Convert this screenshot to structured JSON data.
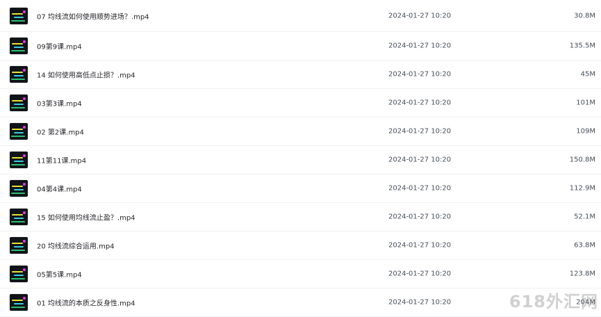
{
  "files": [
    {
      "name": "07 均线流如何使用顺势进场？.mp4",
      "date": "2024-01-27 10:20",
      "size": "30.8M",
      "thumbnail_icon": "video-thumbnail"
    },
    {
      "name": "09第9课.mp4",
      "date": "2024-01-27 10:20",
      "size": "135.5M",
      "thumbnail_icon": "video-thumbnail"
    },
    {
      "name": "14 如何使用高低点止损？.mp4",
      "date": "2024-01-27 10:20",
      "size": "45M",
      "thumbnail_icon": "video-thumbnail"
    },
    {
      "name": "03第3课.mp4",
      "date": "2024-01-27 10:20",
      "size": "101M",
      "thumbnail_icon": "video-thumbnail"
    },
    {
      "name": "02 第2课.mp4",
      "date": "2024-01-27 10:20",
      "size": "109M",
      "thumbnail_icon": "video-thumbnail"
    },
    {
      "name": "11第11课.mp4",
      "date": "2024-01-27 10:20",
      "size": "150.8M",
      "thumbnail_icon": "video-thumbnail"
    },
    {
      "name": "04第4课.mp4",
      "date": "2024-01-27 10:20",
      "size": "112.9M",
      "thumbnail_icon": "video-thumbnail"
    },
    {
      "name": "15 如何使用均线流止盈？.mp4",
      "date": "2024-01-27 10:20",
      "size": "52.1M",
      "thumbnail_icon": "video-thumbnail"
    },
    {
      "name": "20 均线流综合运用.mp4",
      "date": "2024-01-27 10:20",
      "size": "63.8M",
      "thumbnail_icon": "video-thumbnail"
    },
    {
      "name": "05第5课.mp4",
      "date": "2024-01-27 10:20",
      "size": "123.8M",
      "thumbnail_icon": "video-thumbnail"
    },
    {
      "name": "01 均线流的本质之反身性.mp4",
      "date": "2024-01-27 10:20",
      "size": "204M",
      "thumbnail_icon": "video-thumbnail"
    }
  ],
  "watermark": "618外汇网",
  "colors": {
    "text_primary": "#25262b",
    "text_secondary": "#454d5a",
    "divider": "#eef0f4",
    "thumbnail_bg": "#101418"
  }
}
